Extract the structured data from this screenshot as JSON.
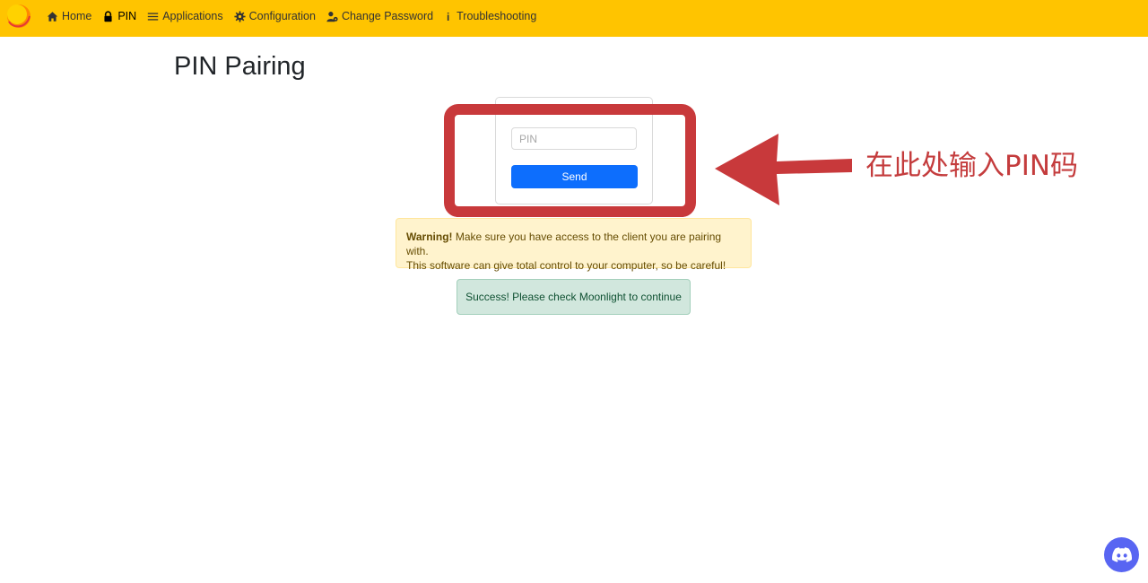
{
  "navbar": {
    "brand_icon": "sunshine-logo",
    "items": [
      {
        "label": "Home",
        "icon": "home-icon"
      },
      {
        "label": "PIN",
        "icon": "lock-icon",
        "active": true
      },
      {
        "label": "Applications",
        "icon": "list-icon"
      },
      {
        "label": "Configuration",
        "icon": "gear-icon"
      },
      {
        "label": "Change Password",
        "icon": "user-gear-icon"
      },
      {
        "label": "Troubleshooting",
        "icon": "info-icon"
      }
    ]
  },
  "page": {
    "title": "PIN Pairing"
  },
  "pin_form": {
    "placeholder": "PIN",
    "value": "",
    "send_label": "Send"
  },
  "annotation": {
    "text": "在此处输入PIN码"
  },
  "warning": {
    "bold": "Warning!",
    "line1": " Make sure you have access to the client you are pairing with.",
    "line2": "This software can give total control to your computer, so be careful!"
  },
  "success": {
    "text": "Success! Please check Moonlight to continue"
  },
  "discord": {
    "icon": "discord-icon"
  },
  "colors": {
    "navbar": "#ffc400",
    "primary": "#0d6efd",
    "annotation_red": "#c8393b",
    "warning_bg": "#fff3cd",
    "success_bg": "#d1e7dd",
    "discord": "#5865f2"
  }
}
